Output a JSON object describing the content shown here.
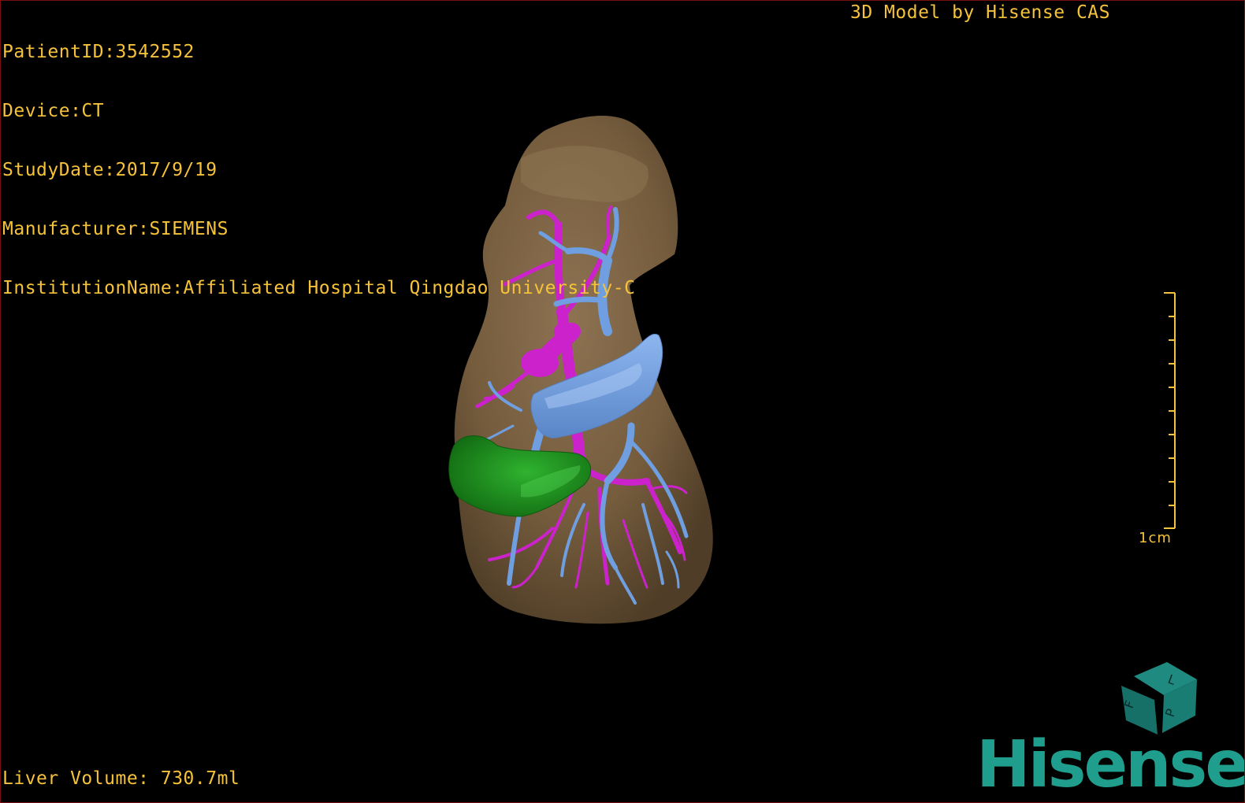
{
  "study_info": {
    "patient_id": "PatientID:3542552",
    "device": "Device:CT",
    "study_date": "StudyDate:2017/9/19",
    "manufacturer": "Manufacturer:SIEMENS",
    "institution": "InstitutionName:Affiliated Hospital Qingdao University-C"
  },
  "credit": "3D Model by Hisense CAS",
  "liver_volume": "Liver Volume: 730.7ml",
  "scale_bar": {
    "label": "1cm"
  },
  "orientation_cube": {
    "face_top": "L",
    "face_left": "F",
    "face_right": "P"
  },
  "brand": "Hisense",
  "colors": {
    "overlay_text": "#f5c23a",
    "liver": "#7a6040",
    "portal_vein": "#6f9fe0",
    "hepatic_artery": "#cc22cc",
    "gallbladder": "#1e8a1e",
    "brand": "#1f9e8e"
  }
}
